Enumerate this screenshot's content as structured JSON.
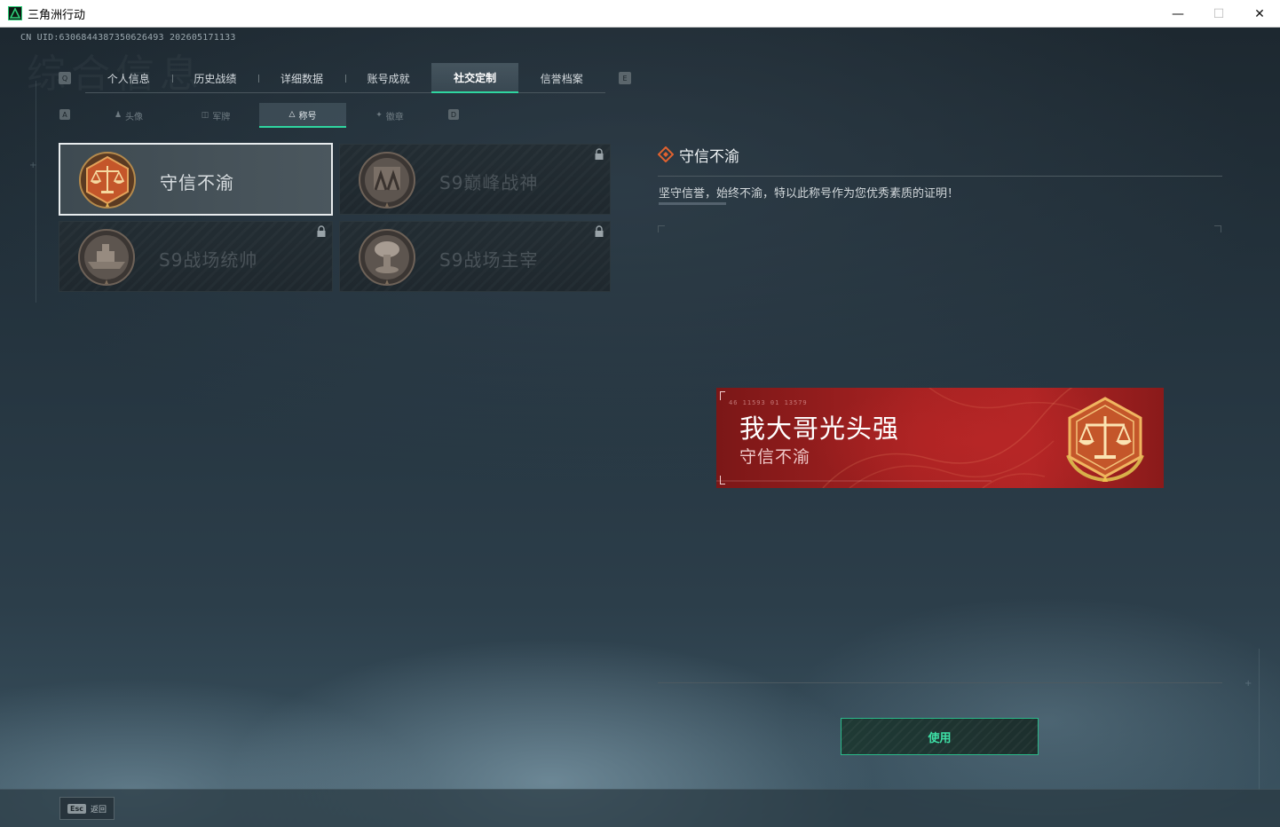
{
  "window": {
    "title": "三角洲行动",
    "minimize": "—",
    "maximize": "☐",
    "close": "✕"
  },
  "uid": "CN UID:6306844387350626493 202605171133",
  "ghost_title": "综合信息",
  "main_tabs": {
    "key_left": "Q",
    "key_right": "E",
    "items": [
      {
        "label": "个人信息",
        "active": false
      },
      {
        "label": "历史战绩",
        "active": false
      },
      {
        "label": "详细数据",
        "active": false
      },
      {
        "label": "账号成就",
        "active": false
      },
      {
        "label": "社交定制",
        "active": true
      },
      {
        "label": "信誉档案",
        "active": false
      }
    ]
  },
  "sub_tabs": {
    "key_left": "A",
    "key_right": "D",
    "items": [
      {
        "label": "头像",
        "icon": "person-icon",
        "active": false
      },
      {
        "label": "军牌",
        "icon": "dogtag-icon",
        "active": false
      },
      {
        "label": "称号",
        "icon": "triangle-icon",
        "active": true
      },
      {
        "label": "徽章",
        "icon": "emblem-icon",
        "active": false
      }
    ]
  },
  "titles": [
    {
      "label": "守信不渝",
      "badge": "scales-badge-icon",
      "locked": false,
      "selected": true
    },
    {
      "label": "S9巅峰战神",
      "badge": "soldier-badge-icon",
      "locked": true,
      "selected": false
    },
    {
      "label": "S9战场统帅",
      "badge": "warship-badge-icon",
      "locked": true,
      "selected": false
    },
    {
      "label": "S9战场主宰",
      "badge": "mushroom-cloud-badge-icon",
      "locked": true,
      "selected": false
    }
  ],
  "detail": {
    "title": "守信不渝",
    "description": "坚守信誉，始终不渝，特以此称号作为您优秀素质的证明！"
  },
  "preview": {
    "player_name": "我大哥光头强",
    "title": "守信不渝",
    "code_text": "46 11593   01 13579"
  },
  "use_button": "使用",
  "footer": {
    "esc_key": "Esc",
    "esc_label": "返回"
  },
  "colors": {
    "accent_green": "#2fd6a0",
    "banner_red": "#a82222",
    "badge_orange": "#c4562a"
  }
}
